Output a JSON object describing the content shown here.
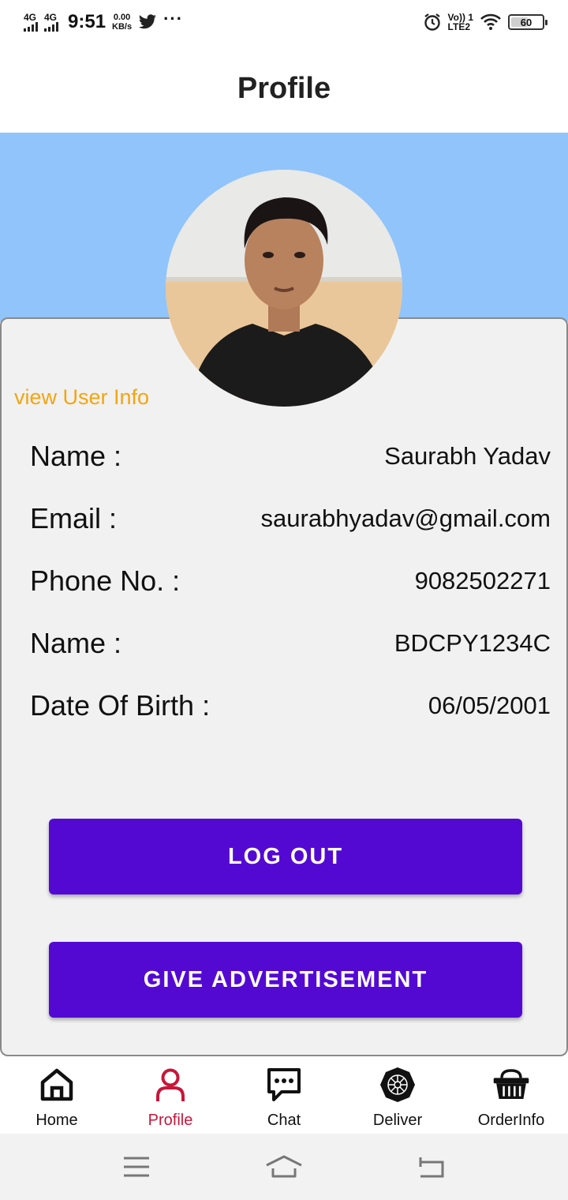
{
  "status_bar": {
    "sim1": "4G",
    "sim2": "4G",
    "time": "9:51",
    "speed_value": "0.00",
    "speed_unit": "KB/s",
    "more": "···",
    "volte": "Vo)) 1",
    "lte": "LTE2",
    "battery": "60",
    "battery_level": 0.6
  },
  "app_bar": {
    "title": "Profile"
  },
  "profile": {
    "view_info_link": "view User Info",
    "rows": [
      {
        "label": "Name :",
        "value": "Saurabh Yadav"
      },
      {
        "label": "Email :",
        "value": "saurabhyadav@gmail.com"
      },
      {
        "label": "Phone No. :",
        "value": "9082502271"
      },
      {
        "label": "Name :",
        "value": "BDCPY1234C"
      },
      {
        "label": "Date Of Birth :",
        "value": "06/05/2001"
      }
    ]
  },
  "actions": {
    "logout": "LOG OUT",
    "advertise": "GIVE ADVERTISEMENT"
  },
  "bottom_nav": {
    "items": [
      {
        "label": "Home",
        "icon": "home-icon"
      },
      {
        "label": "Profile",
        "icon": "person-icon",
        "active": true
      },
      {
        "label": "Chat",
        "icon": "chat-icon"
      },
      {
        "label": "Deliver",
        "icon": "deliver-icon"
      },
      {
        "label": "OrderInfo",
        "icon": "basket-icon"
      }
    ]
  },
  "colors": {
    "banner": "#90c4fb",
    "button": "#5409d3",
    "link": "#f5a40f",
    "active_nav": "#c8163a"
  }
}
